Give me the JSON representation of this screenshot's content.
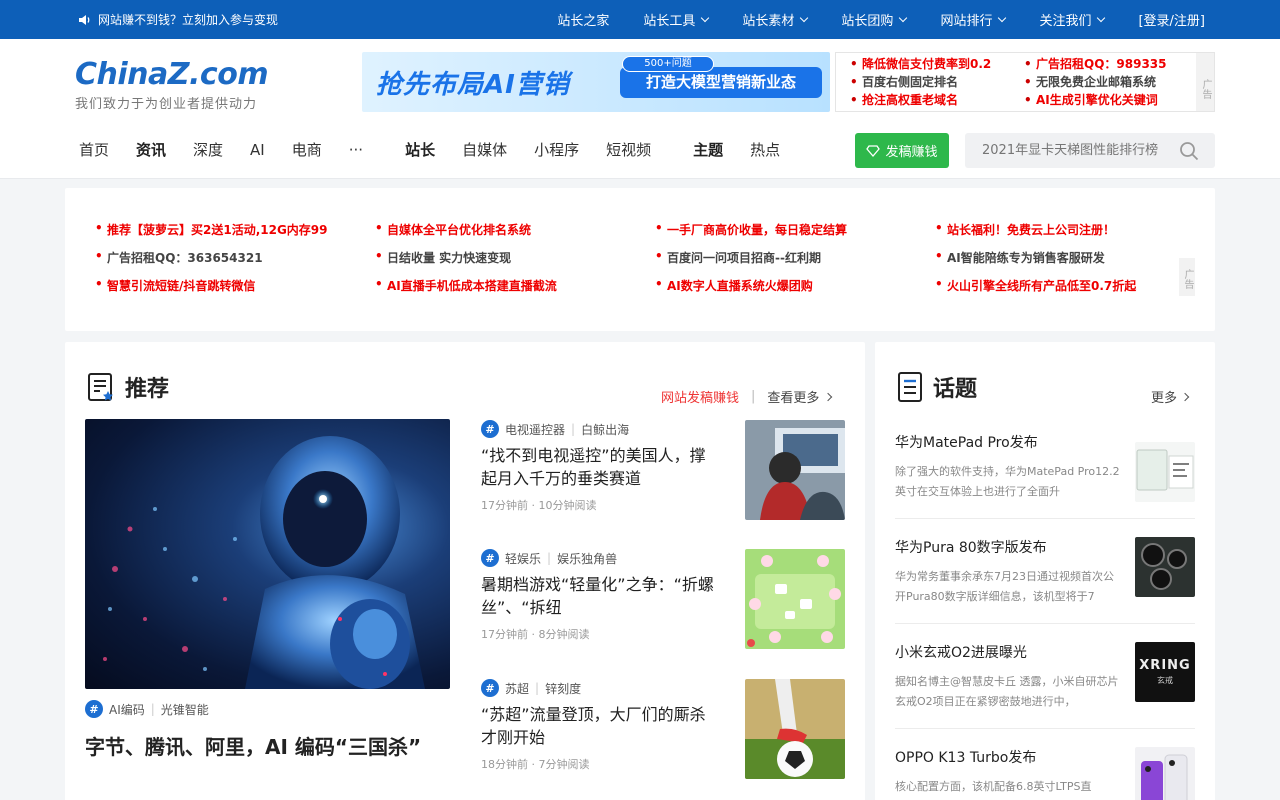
{
  "topbar": {
    "notice": "网站赚不到钱？立刻加入参与变现",
    "nav": [
      {
        "label": "站长之家",
        "dropdown": false
      },
      {
        "label": "站长工具",
        "dropdown": true
      },
      {
        "label": "站长素材",
        "dropdown": true
      },
      {
        "label": "站长团购",
        "dropdown": true
      },
      {
        "label": "网站排行",
        "dropdown": true
      },
      {
        "label": "关注我们",
        "dropdown": true
      },
      {
        "label": "[登录/注册]",
        "dropdown": false
      }
    ]
  },
  "header": {
    "logo": {
      "china": "China",
      "z": "Z",
      "com": ".com"
    },
    "slogan": "我们致力于为创业者提供动力",
    "banner": {
      "headline": "抢先布局AI营销",
      "badge": "500+问题",
      "button": "打造大模型营销新业态"
    },
    "adbox": {
      "col1": [
        "降低微信支付费率到0.2",
        "百度右侧固定排名",
        "抢注高权重老域名"
      ],
      "col2": [
        "广告招租QQ：989335",
        "无限免费企业邮箱系统",
        "AI生成引擎优化关键词"
      ],
      "tag": "广告"
    },
    "nav": [
      "首页",
      "资讯",
      "深度",
      "AI",
      "电商",
      "···",
      "站长",
      "自媒体",
      "小程序",
      "短视频",
      "主题",
      "热点"
    ],
    "post_button": "发稿赚钱",
    "search_placeholder": "2021年显卡天梯图性能排行榜"
  },
  "ad_panel": {
    "items": [
      {
        "text": "推荐【菠萝云】买2送1活动,12G内存99",
        "color": "red"
      },
      {
        "text": "自媒体全平台优化排名系统",
        "color": "red"
      },
      {
        "text": "一手厂商高价收量，每日稳定结算",
        "color": "red"
      },
      {
        "text": "站长福利！免费云上公司注册！",
        "color": "red"
      },
      {
        "text": "广告招租QQ：363654321",
        "color": "gray"
      },
      {
        "text": "日结收量 实力快速变现",
        "color": "gray"
      },
      {
        "text": "百度问一问项目招商--红利期",
        "color": "gray"
      },
      {
        "text": "AI智能陪练专为销售客服研发",
        "color": "gray"
      },
      {
        "text": "智慧引流短链/抖音跳转微信",
        "color": "red"
      },
      {
        "text": "AI直播手机低成本搭建直播截流",
        "color": "red"
      },
      {
        "text": "AI数字人直播系统火爆团购",
        "color": "red"
      },
      {
        "text": "火山引擎全线所有产品低至0.7折起",
        "color": "red"
      }
    ],
    "tag": "广告"
  },
  "recommend": {
    "title": "推荐",
    "link_post": "网站发稿赚钱",
    "link_more": "查看更多",
    "feature": {
      "tag1": "AI编码",
      "tag2": "光锥智能",
      "title": "字节、腾讯、阿里，AI 编码“三国杀”"
    },
    "articles": [
      {
        "tag1": "电视遥控器",
        "tag2": "白鲸出海",
        "title": "“找不到电视遥控”的美国人，撑起月入千万的垂类赛道",
        "time": "17分钟前",
        "read": "10分钟阅读"
      },
      {
        "tag1": "轻娱乐",
        "tag2": "娱乐独角兽",
        "title": "暑期档游戏“轻量化”之争：“折螺丝”、“拆纽",
        "time": "17分钟前",
        "read": "8分钟阅读"
      },
      {
        "tag1": "苏超",
        "tag2": "锌刻度",
        "title": "“苏超”流量登顶，大厂们的厮杀才刚开始",
        "time": "18分钟前",
        "read": "7分钟阅读"
      }
    ]
  },
  "topics": {
    "title": "话题",
    "more": "更多",
    "items": [
      {
        "title": "华为MatePad Pro发布",
        "desc": "除了强大的软件支持，华为MatePad Pro12.2英寸在交互体验上也进行了全面升"
      },
      {
        "title": "华为Pura 80数字版发布",
        "desc": "华为常务董事余承东7月23日通过视频首次公开Pura80数字版详细信息，该机型将于7"
      },
      {
        "title": "小米玄戒O2进展曝光",
        "desc": "据知名博主@智慧皮卡丘 透露，小米自研芯片玄戒O2项目正在紧锣密鼓地进行中，",
        "thumb_text": "XRING",
        "thumb_sub": "玄戒"
      },
      {
        "title": "OPPO K13 Turbo发布",
        "desc": "核心配置方面，该机配备6.8英寸LTPS直"
      }
    ]
  },
  "colors": {
    "brand_blue": "#0d5fb8",
    "accent_red": "#e00000",
    "post_green": "#2eb84b"
  }
}
